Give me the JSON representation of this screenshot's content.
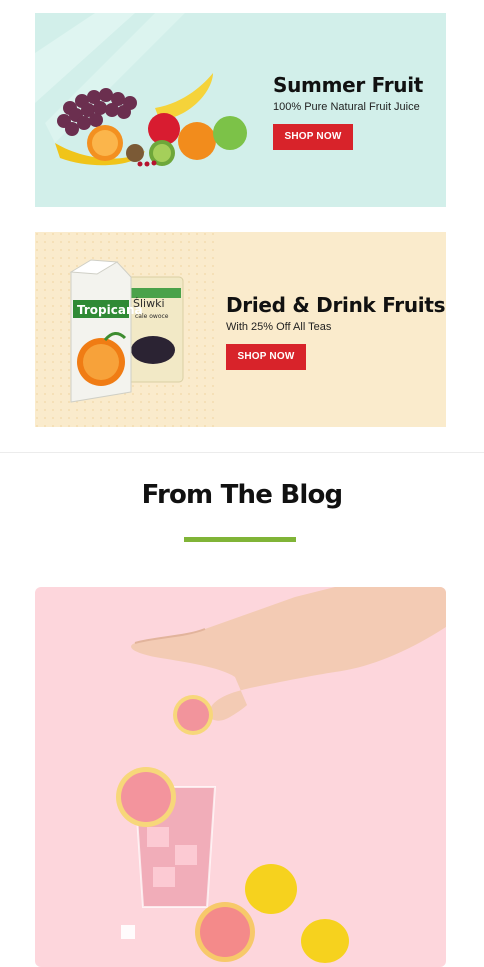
{
  "banners": [
    {
      "title": "Summer Fruit",
      "subtitle": "100% Pure Natural Fruit Juice",
      "button_label": "SHOP NOW",
      "background": "#d2efea",
      "button_color": "#d8232a"
    },
    {
      "title": "Dried & Drink Fruits",
      "subtitle": "With 25% Off All Teas",
      "button_label": "SHOP NOW",
      "background": "#faebcc",
      "button_color": "#d8232a",
      "product_labels": {
        "carton_brand": "Tropicana",
        "bag_brand": "Śliwki",
        "bag_sub": "cale owoce"
      }
    }
  ],
  "blog": {
    "heading": "From The Blog",
    "underline_color": "#80b437",
    "card_background": "#fdd6dc"
  }
}
